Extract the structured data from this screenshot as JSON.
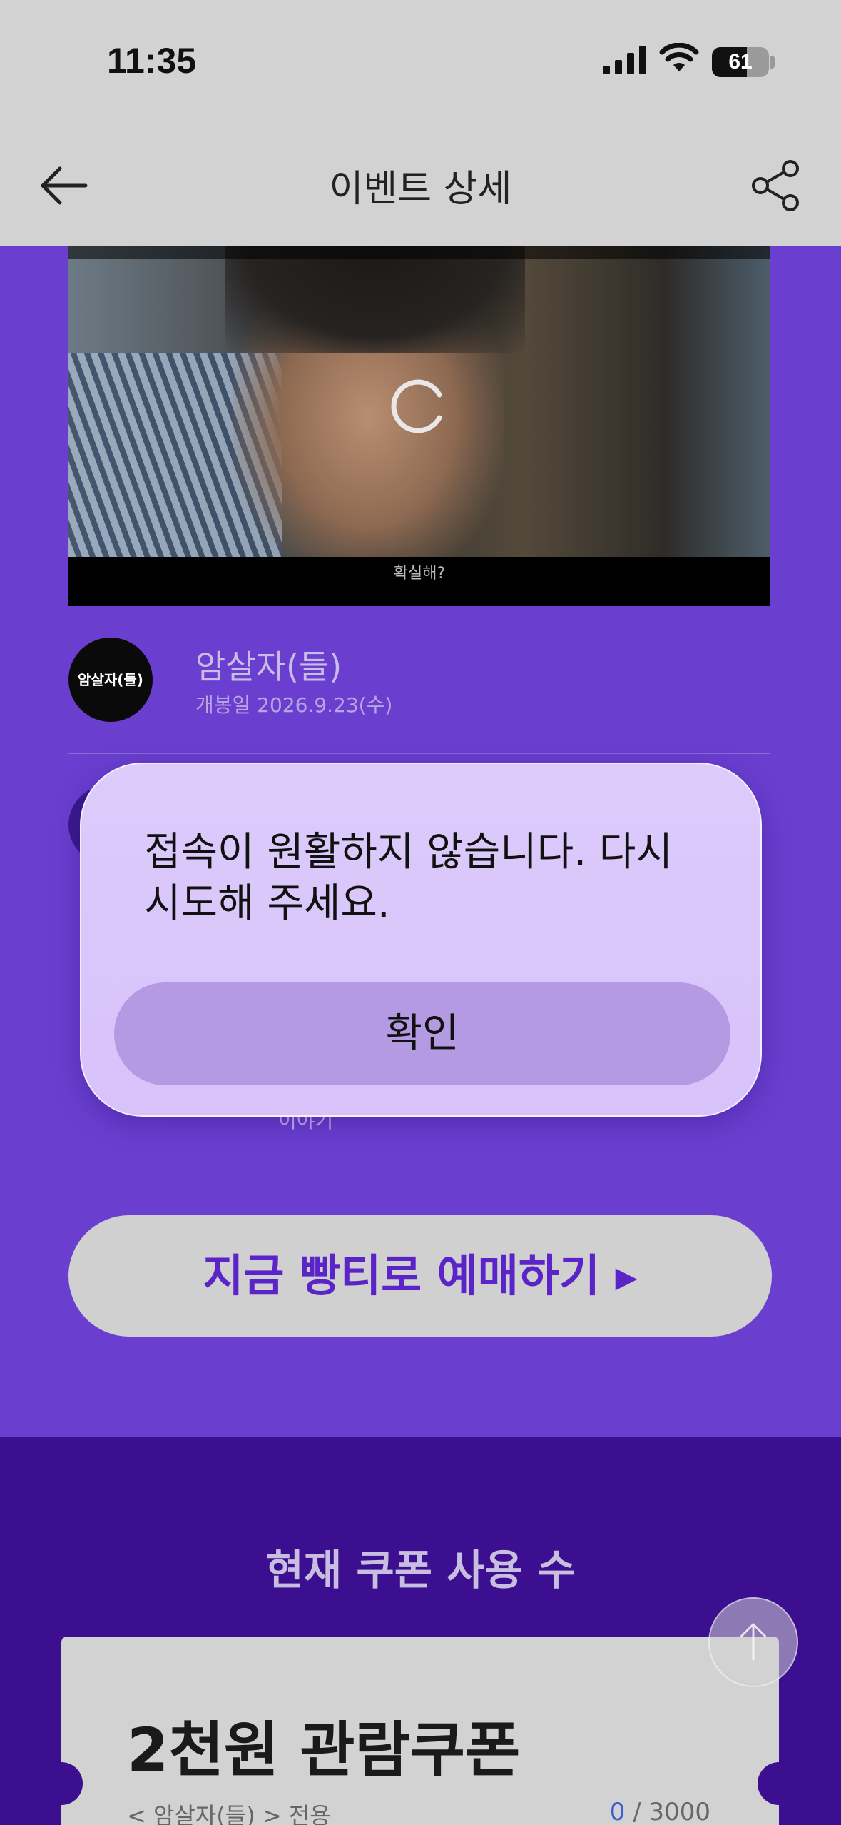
{
  "status_bar": {
    "time": "11:35",
    "battery": "61",
    "battery_level": 0.61
  },
  "header": {
    "title": "이벤트 상세"
  },
  "video": {
    "caption": "확실해?"
  },
  "movie": {
    "logo_text": "암살자(들)",
    "name": "암살자(들)",
    "release_date": "개봉일 2026.9.23(수)"
  },
  "blurred_content": {
    "partial_text": "이야기"
  },
  "cta": {
    "label": "지금 빵티로 예매하기 ▸"
  },
  "coupon_section": {
    "title": "현재 쿠폰 사용 수",
    "coupon_name": "2천원 관람쿠폰",
    "coupon_sub": "< 암살자(들) > 전용",
    "used": "0",
    "total": " / 3000"
  },
  "modal": {
    "message": "접속이 원활하지 않습니다. 다시 시도해 주세요.",
    "confirm_label": "확인"
  },
  "colors": {
    "page_bg": "#6a3fd0",
    "footer_bg": "#3b0f8f",
    "cta_text": "#5a24c9",
    "modal_bg": "#dccbfb",
    "modal_button": "#b39ae3"
  }
}
